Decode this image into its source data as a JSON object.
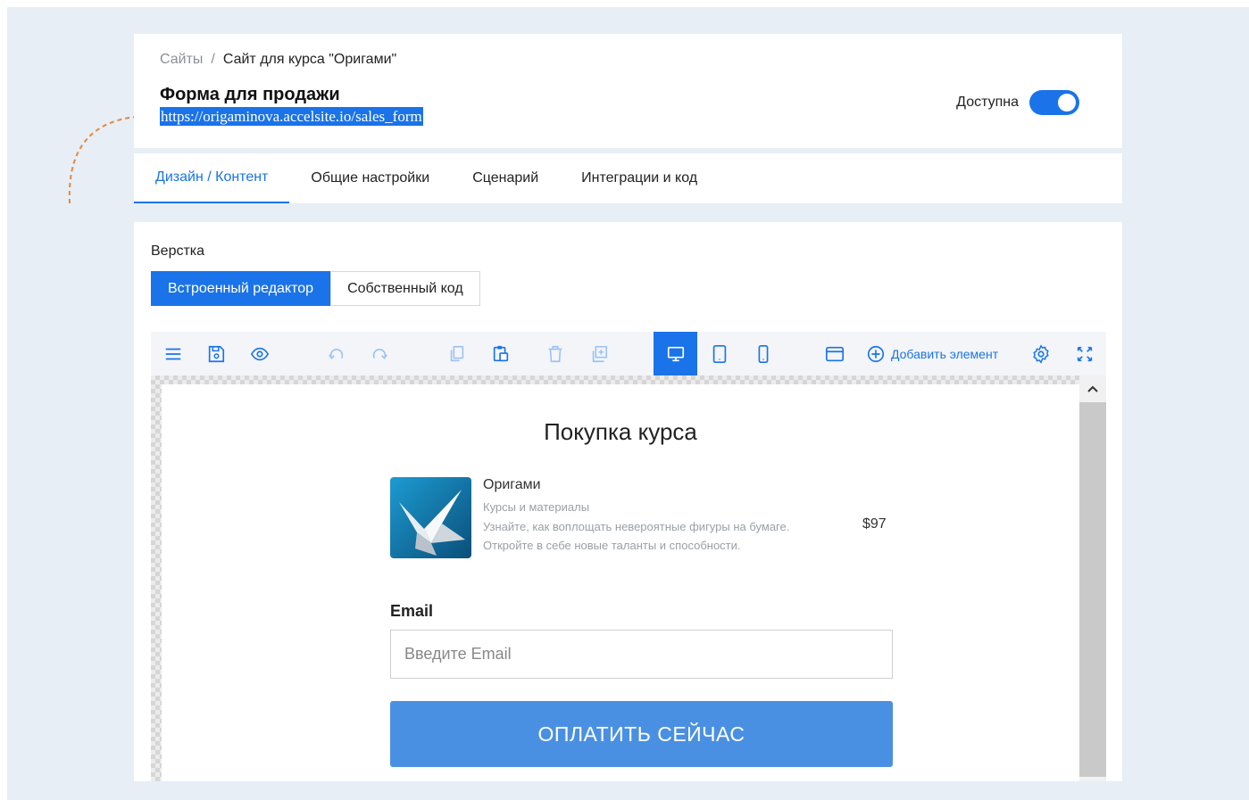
{
  "breadcrumb": {
    "root": "Сайты",
    "separator": "/",
    "current": "Сайт для курса \"Оригами\""
  },
  "page": {
    "title": "Форма для продажи",
    "url": "https://origaminova.accelsite.io/sales_form"
  },
  "availability": {
    "label": "Доступна",
    "enabled": true
  },
  "tabs": [
    {
      "label": "Дизайн / Контент",
      "active": true
    },
    {
      "label": "Общие настройки",
      "active": false
    },
    {
      "label": "Сценарий",
      "active": false
    },
    {
      "label": "Интеграции и код",
      "active": false
    }
  ],
  "layout_section": {
    "label": "Верстка",
    "modes": [
      {
        "label": "Встроенный редактор",
        "active": true
      },
      {
        "label": "Собственный код",
        "active": false
      }
    ]
  },
  "toolbar": {
    "add_element_label": "Добавить элемент",
    "icons": [
      "menu-icon",
      "save-icon",
      "preview-eye-icon",
      "undo-icon",
      "redo-icon",
      "copy-icon",
      "paste-icon",
      "delete-icon",
      "duplicate-icon",
      "desktop-icon",
      "tablet-icon",
      "mobile-icon",
      "browser-window-icon",
      "add-element-icon",
      "settings-gear-icon",
      "fullscreen-icon"
    ],
    "active_device": "desktop"
  },
  "form": {
    "title": "Покупка курса",
    "product": {
      "name": "Оригами",
      "category": "Курсы и материалы",
      "description": "Узнайте, как воплощать невероятные фигуры на бумаге. Откройте в себе новые таланты и способности.",
      "price": "$97"
    },
    "email_label": "Email",
    "email_placeholder": "Введите Email",
    "email_value": "",
    "submit_label": "ОПЛАТИТЬ СЕЙЧАС"
  },
  "colors": {
    "accent": "#1a73e8",
    "pay_button": "#4a90e2",
    "page_background": "#e8eef6",
    "annotation_arrow": "#e8873a"
  }
}
